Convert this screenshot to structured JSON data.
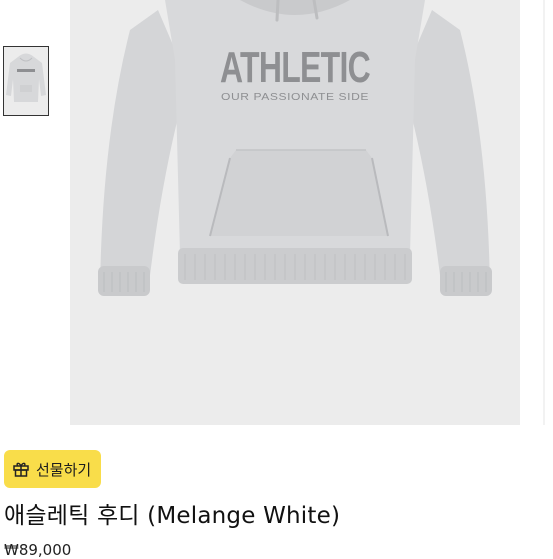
{
  "product": {
    "title": "애슬레틱 후디 (Melange White)",
    "price": "₩89,000",
    "graphic_text": "ATHLETIC",
    "graphic_subtext": "OUR PASSIONATE SIDE",
    "color_name": "Melange White",
    "image_background": "#ececec",
    "hoodie_color": "#d7d8da",
    "print_color": "#8e8f92"
  },
  "gift_button": {
    "label": "선물하기",
    "icon": "gift-icon",
    "color": "#f9dd4a"
  },
  "gallery": {
    "thumbnail_count": 1,
    "selected_index": 0
  }
}
